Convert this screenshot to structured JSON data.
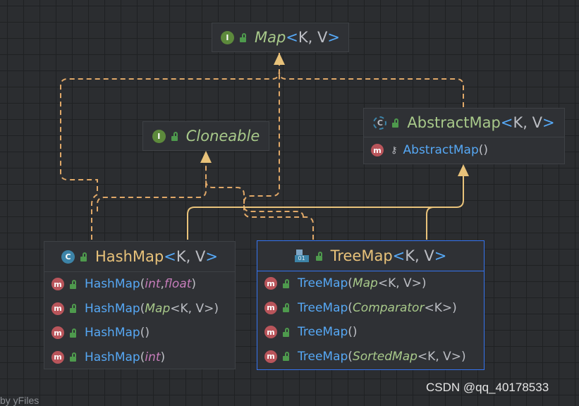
{
  "nodes": {
    "map": {
      "badge": "I",
      "name": "Map",
      "generic": "K, V"
    },
    "cloneable": {
      "badge": "I",
      "name": "Cloneable"
    },
    "abstract_map": {
      "badge": "C",
      "name": "AbstractMap",
      "generic": "K, V",
      "members": [
        {
          "fn": "AbstractMap",
          "args": "()"
        }
      ]
    },
    "hashmap": {
      "badge": "C",
      "name": "HashMap",
      "generic": "K, V",
      "members": [
        {
          "fn": "HashMap",
          "a1": "int",
          "sep": ", ",
          "a2": "float"
        },
        {
          "fn": "HashMap",
          "a1": "Map",
          "a2": "<K, V>"
        },
        {
          "fn": "HashMap",
          "args": "()"
        },
        {
          "fn": "HashMap",
          "a1": "int"
        }
      ]
    },
    "treemap": {
      "badge": "01",
      "name": "TreeMap",
      "generic": "K, V",
      "members": [
        {
          "fn": "TreeMap",
          "a1": "Map",
          "a2": "<K, V>"
        },
        {
          "fn": "TreeMap",
          "a1": "Comparator",
          "a2": "<K>"
        },
        {
          "fn": "TreeMap",
          "args": "()"
        },
        {
          "fn": "TreeMap",
          "a1": "SortedMap",
          "a2": "<K, V>"
        }
      ]
    }
  },
  "member_badge": "m",
  "colors": {
    "background": "#2b2d30",
    "realization_edge": "#e0a868",
    "generalization_edge": "#e8c27a",
    "selected_border": "#3574f0"
  },
  "watermark": "CSDN @qq_40178533",
  "footer": "by yFiles"
}
